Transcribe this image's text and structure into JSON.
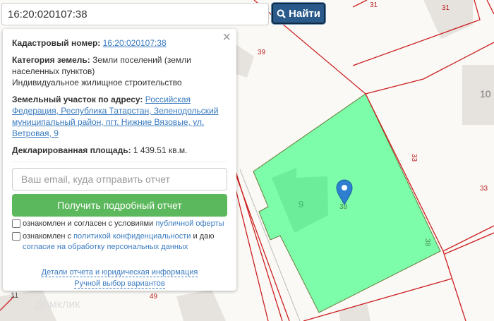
{
  "search": {
    "value": "16:20:020107:38",
    "button_label": "Найти",
    "icon": "search-icon"
  },
  "map": {
    "parcel_color": "#7dfda9",
    "labels": {
      "l31a": "31",
      "l31b": "31",
      "l39": "39",
      "l10": "10",
      "l9": "9",
      "l38a": "38",
      "l38b": "38",
      "l33a": "33",
      "l33b": "33",
      "l49": "49",
      "l11": "11"
    },
    "watermark": "Домклик"
  },
  "panel": {
    "close": "×",
    "cadastral_label": "Кадастровый номер:",
    "cadastral_value": "16:20:020107:38",
    "category_label": "Категория земель:",
    "category_value": "Земли поселений (земли населенных пунктов)",
    "usage": "Индивидуальное жилищное строительство",
    "address_label": "Земельный участок по адресу:",
    "address_value": "Российская Федерация, Республика Татарстан, Зеленодольский муниципальный район, пгт. Нижние Вязовые, ул. Ветровая, 9",
    "area_label": "Декларированная площадь:",
    "area_value": "1 439.51 кв.м.",
    "email_placeholder": "Ваш email, куда отправить отчет",
    "report_button": "Получить подробный отчет",
    "check1_text": "ознакомлен и согласен с условиями ",
    "check1_link": "публичной оферты",
    "check2_text": "ознакомлен с ",
    "check2_link": "политикой конфиденциальности",
    "check2_mid": " и даю ",
    "check2_link2": "согласие на обработку персональных данных",
    "details_link": "Детали отчета и юридическая информация",
    "manual_link": "Ручной выбор вариантов"
  }
}
